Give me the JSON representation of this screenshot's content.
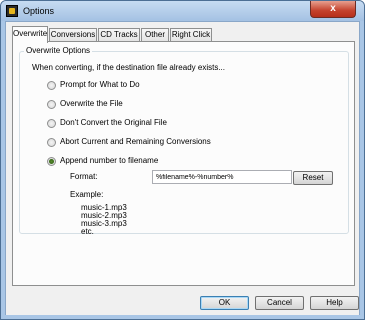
{
  "window": {
    "title": "Options",
    "close_glyph": "x"
  },
  "tabs": [
    {
      "label": "Overwrite",
      "active": true
    },
    {
      "label": "Conversions",
      "active": false
    },
    {
      "label": "CD Tracks",
      "active": false
    },
    {
      "label": "Other",
      "active": false
    },
    {
      "label": "Right Click",
      "active": false
    }
  ],
  "overwrite": {
    "group_title": "Overwrite Options",
    "intro": "When converting, if the destination file already exists...",
    "options": [
      {
        "label": "Prompt for What to Do",
        "selected": false
      },
      {
        "label": "Overwrite the File",
        "selected": false
      },
      {
        "label": "Don't Convert the Original File",
        "selected": false
      },
      {
        "label": "Abort Current and Remaining Conversions",
        "selected": false
      },
      {
        "label": "Append number to filename",
        "selected": true
      }
    ],
    "format_label": "Format:",
    "format_value": "%filename%-%number%",
    "reset_label": "Reset",
    "example_label": "Example:",
    "example_lines": [
      "music-1.mp3",
      "music-2.mp3",
      "music-3.mp3",
      "etc."
    ]
  },
  "buttons": {
    "ok": "OK",
    "cancel": "Cancel",
    "help": "Help"
  },
  "colors": {
    "frame": "#a9c6e6",
    "close": "#c4412c",
    "selected_radio": "#3a7a1c"
  }
}
